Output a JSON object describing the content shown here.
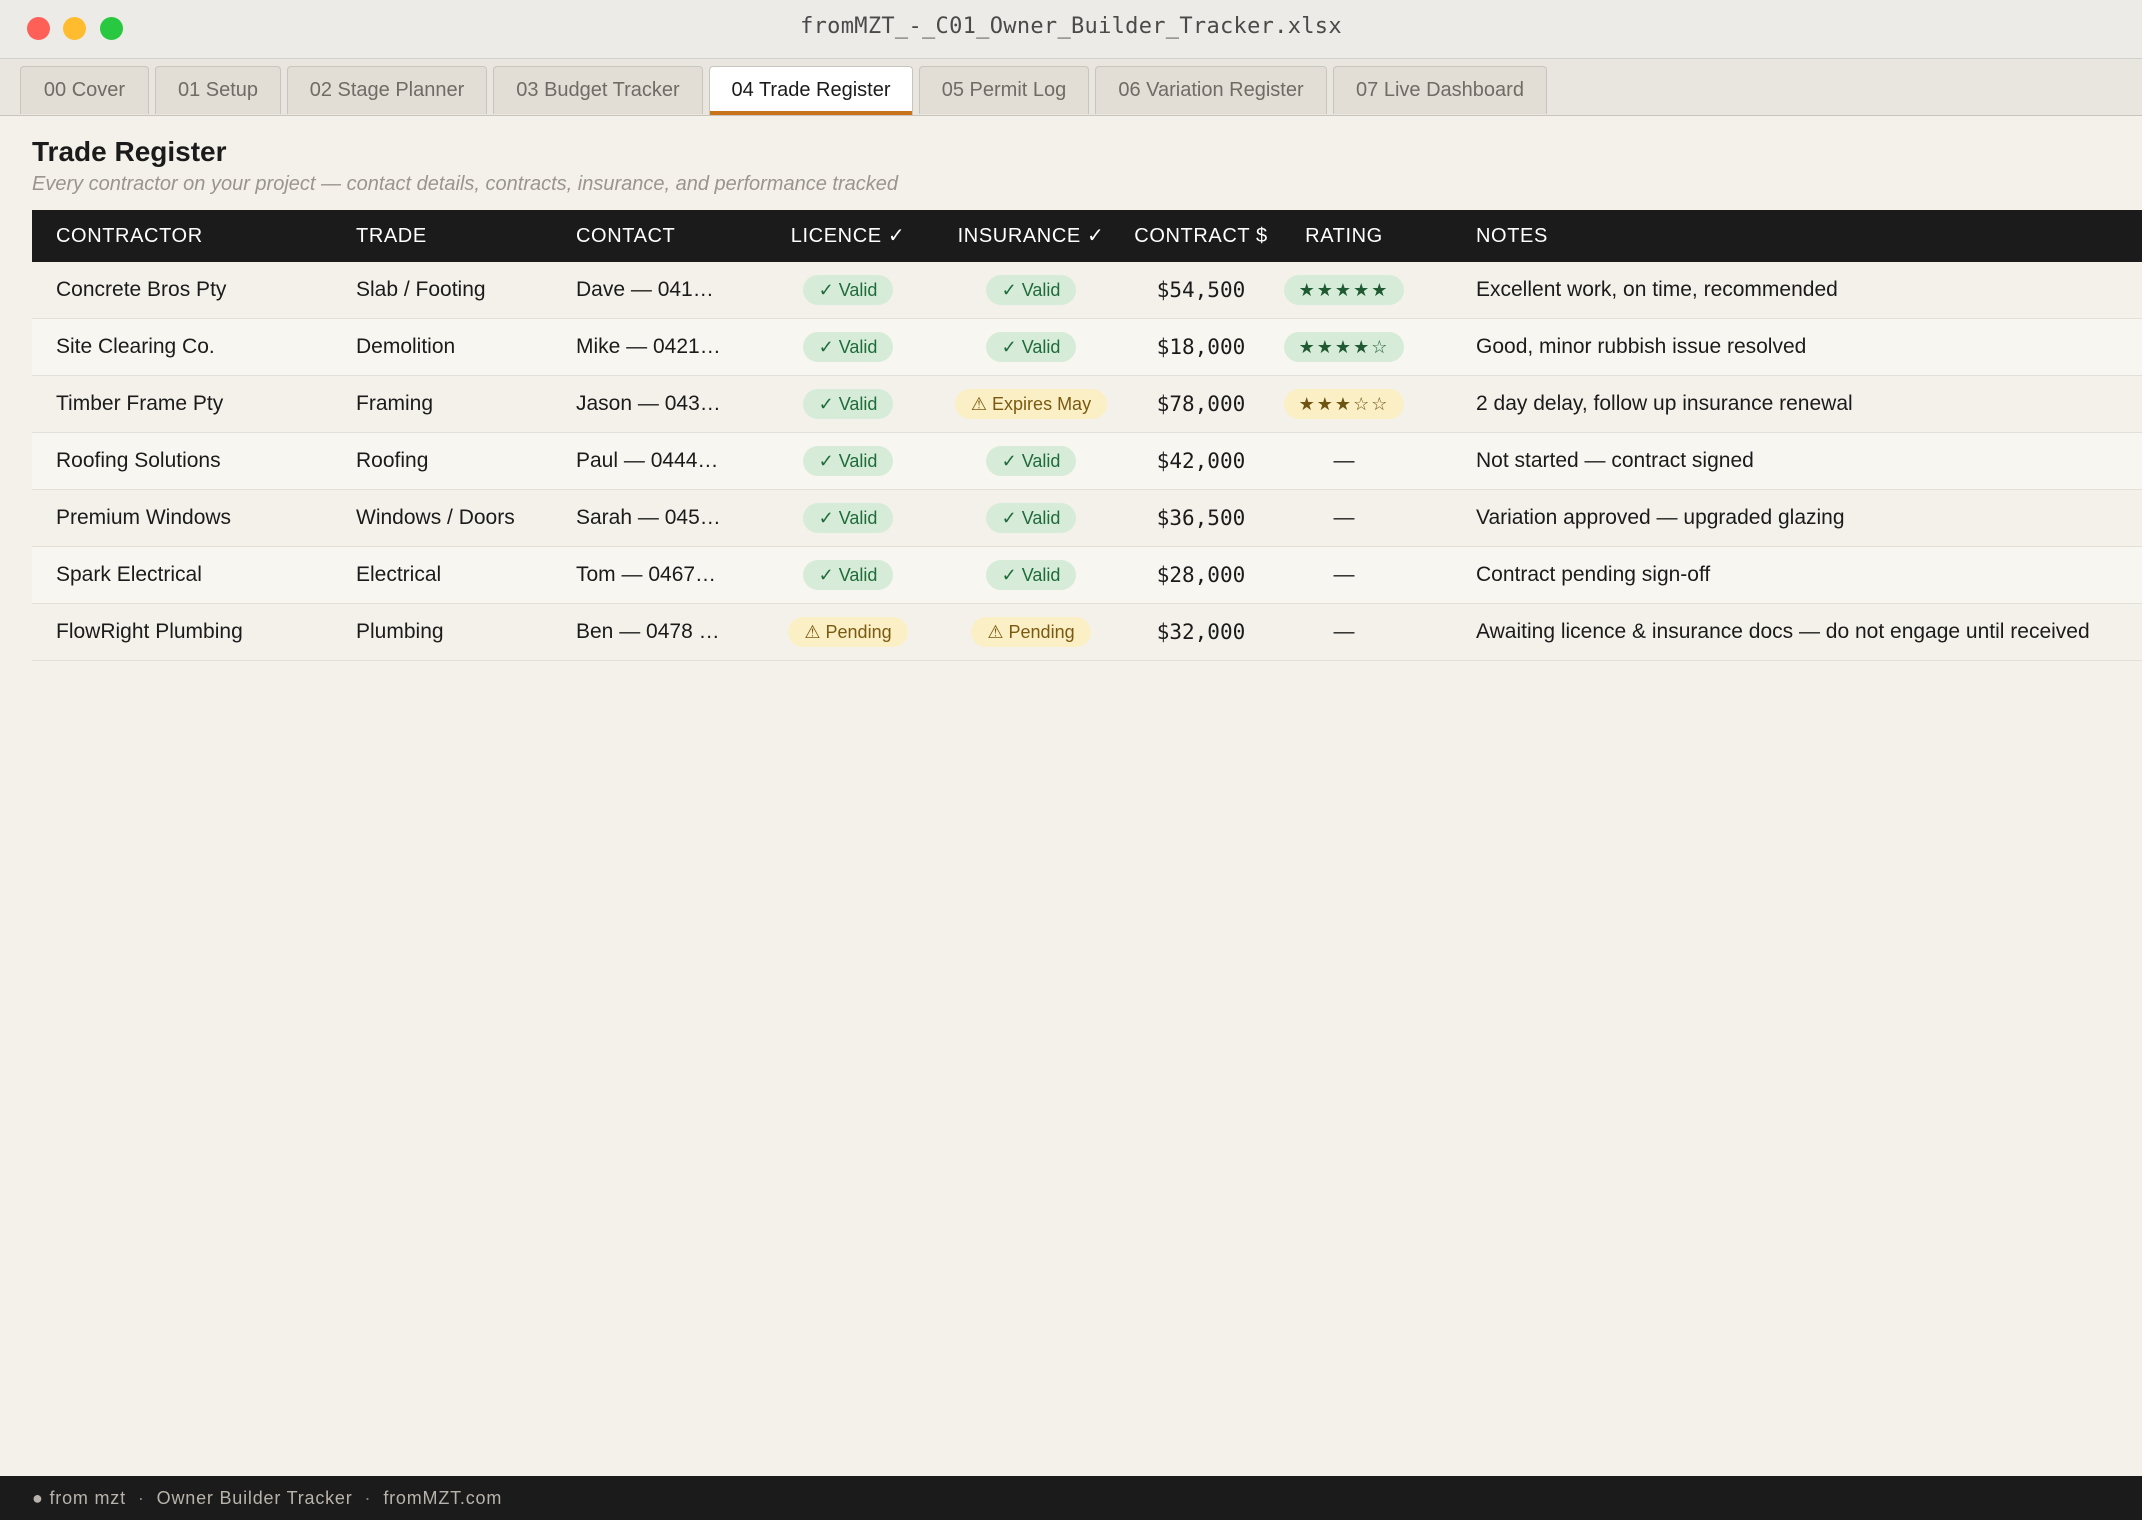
{
  "window": {
    "title": "fromMZT_-_C01_Owner_Builder_Tracker.xlsx"
  },
  "tabs": [
    {
      "label": "00 Cover",
      "active": false
    },
    {
      "label": "01 Setup",
      "active": false
    },
    {
      "label": "02 Stage Planner",
      "active": false
    },
    {
      "label": "03 Budget Tracker",
      "active": false
    },
    {
      "label": "04 Trade Register",
      "active": true
    },
    {
      "label": "05 Permit Log",
      "active": false
    },
    {
      "label": "06 Variation Register",
      "active": false
    },
    {
      "label": "07 Live Dashboard",
      "active": false
    }
  ],
  "page": {
    "title": "Trade Register",
    "subtitle": "Every contractor on your project — contact details, contracts, insurance, and performance tracked"
  },
  "table": {
    "headers": [
      "CONTRACTOR",
      "TRADE",
      "CONTACT",
      "LICENCE ✓",
      "INSURANCE ✓",
      "CONTRACT $",
      "RATING",
      "NOTES"
    ],
    "rows": [
      {
        "contractor": "Concrete Bros Pty",
        "trade": "Slab / Footing",
        "contact": "Dave — 041…",
        "licence": {
          "text": "✓ Valid",
          "status": "ok"
        },
        "insurance": {
          "text": "✓ Valid",
          "status": "ok"
        },
        "contract": "$54,500",
        "rating": {
          "text": "★★★★★",
          "stars": 5,
          "status": "good"
        },
        "notes": "Excellent work, on time, recommended"
      },
      {
        "contractor": "Site Clearing Co.",
        "trade": "Demolition",
        "contact": "Mike — 0421…",
        "licence": {
          "text": "✓ Valid",
          "status": "ok"
        },
        "insurance": {
          "text": "✓ Valid",
          "status": "ok"
        },
        "contract": "$18,000",
        "rating": {
          "text": "★★★★☆",
          "stars": 4,
          "status": "good"
        },
        "notes": "Good, minor rubbish issue resolved"
      },
      {
        "contractor": "Timber Frame Pty",
        "trade": "Framing",
        "contact": "Jason — 043…",
        "licence": {
          "text": "✓ Valid",
          "status": "ok"
        },
        "insurance": {
          "text": "⚠ Expires May",
          "status": "warn"
        },
        "contract": "$78,000",
        "rating": {
          "text": "★★★☆☆",
          "stars": 3,
          "status": "mid"
        },
        "notes": "2 day delay, follow up insurance renewal"
      },
      {
        "contractor": "Roofing Solutions",
        "trade": "Roofing",
        "contact": "Paul — 0444…",
        "licence": {
          "text": "✓ Valid",
          "status": "ok"
        },
        "insurance": {
          "text": "✓ Valid",
          "status": "ok"
        },
        "contract": "$42,000",
        "rating": {
          "text": "—",
          "stars": null,
          "status": "none"
        },
        "notes": "Not started — contract signed"
      },
      {
        "contractor": "Premium Windows",
        "trade": "Windows / Doors",
        "contact": "Sarah — 045…",
        "licence": {
          "text": "✓ Valid",
          "status": "ok"
        },
        "insurance": {
          "text": "✓ Valid",
          "status": "ok"
        },
        "contract": "$36,500",
        "rating": {
          "text": "—",
          "stars": null,
          "status": "none"
        },
        "notes": "Variation approved — upgraded glazing"
      },
      {
        "contractor": "Spark Electrical",
        "trade": "Electrical",
        "contact": "Tom — 0467…",
        "licence": {
          "text": "✓ Valid",
          "status": "ok"
        },
        "insurance": {
          "text": "✓ Valid",
          "status": "ok"
        },
        "contract": "$28,000",
        "rating": {
          "text": "—",
          "stars": null,
          "status": "none"
        },
        "notes": "Contract pending sign-off"
      },
      {
        "contractor": "FlowRight Plumbing",
        "trade": "Plumbing",
        "contact": "Ben — 0478 …",
        "licence": {
          "text": "⚠ Pending",
          "status": "warn"
        },
        "insurance": {
          "text": "⚠ Pending",
          "status": "warn"
        },
        "contract": "$32,000",
        "rating": {
          "text": "—",
          "stars": null,
          "status": "none"
        },
        "notes": "Awaiting licence & insurance docs — do not engage until received"
      }
    ]
  },
  "footer": {
    "brand": "● from mzt",
    "product": "Owner Builder Tracker",
    "site": "fromMZT.com",
    "separator": "·"
  },
  "colors": {
    "accent": "#c8741d",
    "header_bg": "#1b1b1b",
    "ok_bg": "#d6ecd8",
    "ok_text": "#1f6b3a",
    "warn_bg": "#fbefc6",
    "warn_text": "#7a5a10",
    "page_bg": "#f4f1ea"
  }
}
